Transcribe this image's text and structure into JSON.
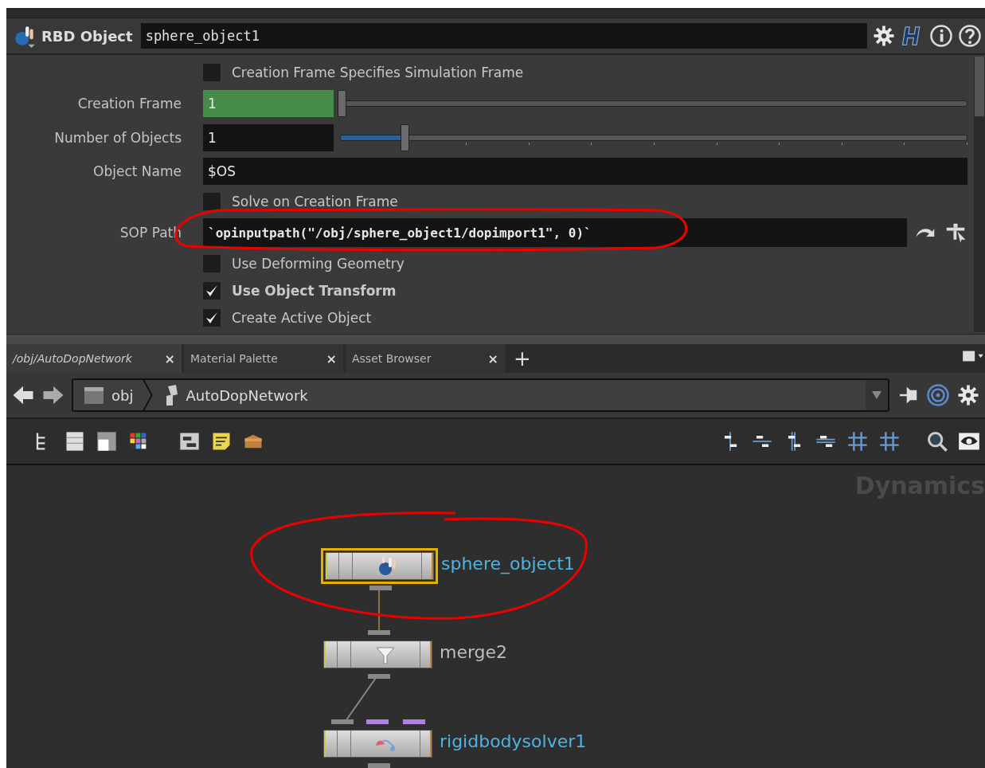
{
  "header": {
    "type": "RBD Object",
    "name": "sphere_object1"
  },
  "parameters": [
    {
      "kind": "checkbox",
      "label": "Creation Frame Specifies Simulation Frame",
      "checked": false,
      "modified": false
    },
    {
      "kind": "slider",
      "label": "Creation Frame",
      "value": "1",
      "level": 0,
      "keyed": true,
      "ticks": false
    },
    {
      "kind": "slider",
      "label": "Number of Objects",
      "value": "1",
      "level": 0.1,
      "keyed": false,
      "ticks": true
    },
    {
      "kind": "text",
      "label": "Object Name",
      "value": "$OS"
    },
    {
      "kind": "checkbox",
      "label": "Solve on Creation Frame",
      "checked": false,
      "modified": false
    },
    {
      "kind": "path",
      "label": "SOP Path",
      "value": "`opinputpath(\"/obj/sphere_object1/dopimport1\", 0)`"
    },
    {
      "kind": "checkbox",
      "label": "Use Deforming Geometry",
      "checked": false,
      "modified": false
    },
    {
      "kind": "checkbox",
      "label": "Use Object Transform",
      "checked": true,
      "modified": true
    },
    {
      "kind": "checkbox",
      "label": "Create Active Object",
      "checked": true,
      "modified": false
    }
  ],
  "tabs": [
    {
      "label": "/obj/AutoDopNetwork",
      "selected": true,
      "close": "×"
    },
    {
      "label": "Material Palette",
      "selected": false,
      "close": "×"
    },
    {
      "label": "Asset Browser",
      "selected": false,
      "close": "×"
    }
  ],
  "add_tab": "+",
  "path": [
    "obj",
    "AutoDopNetwork"
  ],
  "network": {
    "watermark": "Dynamics",
    "nodes": [
      {
        "name": "sphere_object1",
        "selected": true,
        "color": "#4fb3e0",
        "kind": "sphere"
      },
      {
        "name": "merge2",
        "selected": false,
        "color": "#bdbdbd",
        "kind": "merge"
      },
      {
        "name": "rigidbodysolver1",
        "selected": false,
        "color": "#4fb3e0",
        "kind": "solver"
      }
    ]
  }
}
